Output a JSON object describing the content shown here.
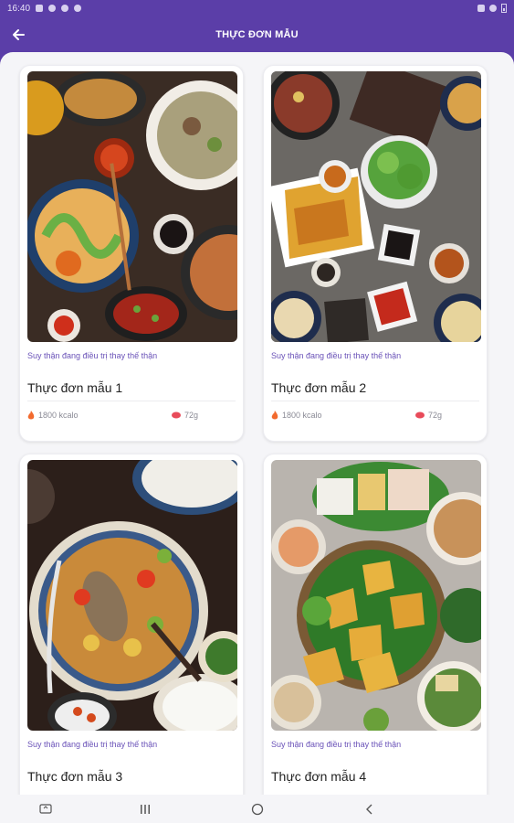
{
  "status_bar": {
    "time": "16:40"
  },
  "app_bar": {
    "title": "THỰC ĐƠN MẪU"
  },
  "cards": [
    {
      "category": "Suy thận đang điều trị thay thế thận",
      "title": "Thực đơn mẫu 1",
      "calories": "1800 kcalo",
      "protein": "72g",
      "image_icon": "vietnamese-noodle-spread-photo"
    },
    {
      "category": "Suy thận đang điều trị thay thế thận",
      "title": "Thực đơn mẫu 2",
      "calories": "1800 kcalo",
      "protein": "72g",
      "image_icon": "banh-xeo-table-photo"
    },
    {
      "category": "Suy thận đang điều trị thay thế thận",
      "title": "Thực đơn mẫu 3",
      "image_icon": "fish-soup-rice-photo"
    },
    {
      "category": "Suy thận đang điều trị thay thế thận",
      "title": "Thực đơn mẫu 4",
      "image_icon": "crepe-platter-photo"
    }
  ],
  "colors": {
    "primary": "#5b3ea8",
    "accent_flame": "#f26a2e",
    "accent_protein": "#e84b5a",
    "background": "#f5f5f8"
  }
}
